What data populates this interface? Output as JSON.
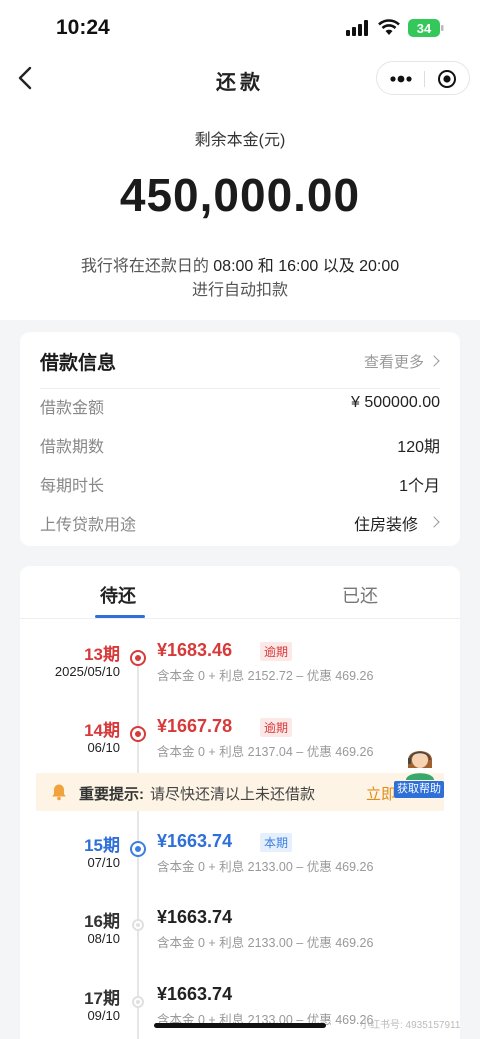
{
  "status": {
    "time": "10:24",
    "battery": "34"
  },
  "nav": {
    "title": "还款"
  },
  "hero": {
    "label": "剩余本金(元)",
    "amount": "450,000.00",
    "note_prefix": "我行将在还款日的",
    "note_times": " 08:00 和 16:00 以及 20:00",
    "note_line2": "进行自动扣款"
  },
  "loan_info": {
    "title": "借款信息",
    "more": "查看更多",
    "rows": [
      {
        "label": "借款金额",
        "value": "¥ 500000.00"
      },
      {
        "label": "借款期数",
        "value": "120期"
      },
      {
        "label": "每期时长",
        "value": "1个月"
      },
      {
        "label": "上传贷款用途",
        "value": "住房装修"
      }
    ]
  },
  "tabs": {
    "pending": "待还",
    "paid": "已还"
  },
  "schedule": [
    {
      "period": "13期",
      "date": "2025/05/10",
      "amount": "¥1683.46",
      "badge": "逾期",
      "detail": "含本金 0 + 利息 2152.72 – 优惠 469.26"
    },
    {
      "period": "14期",
      "date": "06/10",
      "amount": "¥1667.78",
      "badge": "逾期",
      "detail": "含本金 0 + 利息 2137.04 – 优惠 469.26"
    },
    {
      "period": "15期",
      "date": "07/10",
      "amount": "¥1663.74",
      "badge": "本期",
      "detail": "含本金 0 + 利息 2133.00 – 优惠 469.26"
    },
    {
      "period": "16期",
      "date": "08/10",
      "amount": "¥1663.74",
      "badge": "",
      "detail": "含本金 0 + 利息 2133.00 – 优惠 469.26"
    },
    {
      "period": "17期",
      "date": "09/10",
      "amount": "¥1663.74",
      "badge": "",
      "detail": "含本金 0 + 利息 2133.00 – 优惠 469.26"
    }
  ],
  "notice": {
    "title": "重要提示:",
    "text": "请尽快还清以上未还借款",
    "action": "立即"
  },
  "helper": {
    "label": "获取帮助"
  },
  "watermark": "小红书号: 4935157911",
  "colors": {
    "accent": "#2e6fd8",
    "overdue": "#d73a3a",
    "warning": "#e08c1a"
  }
}
